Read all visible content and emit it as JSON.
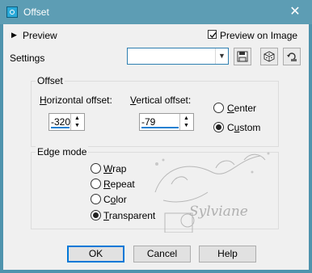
{
  "window": {
    "title": "Offset",
    "close_symbol": "✕"
  },
  "preview": {
    "label": "Preview",
    "arrow": "▶"
  },
  "preview_on_image": {
    "label": "Preview on Image",
    "checked": true
  },
  "settings": {
    "label": "Settings",
    "value": ""
  },
  "offset": {
    "group_label": "Offset",
    "horizontal": {
      "label": "Horizontal offset:",
      "value": "-320"
    },
    "vertical": {
      "label": "Vertical offset:",
      "value": "-79"
    },
    "center_label": "Center",
    "custom_label": "Custom",
    "selected": "Custom"
  },
  "edge_mode": {
    "group_label": "Edge mode",
    "options": [
      "Wrap",
      "Repeat",
      "Color",
      "Transparent"
    ],
    "selected": "Transparent"
  },
  "watermark": {
    "text": "Sylviane"
  },
  "buttons": {
    "ok": "OK",
    "cancel": "Cancel",
    "help": "Help"
  }
}
